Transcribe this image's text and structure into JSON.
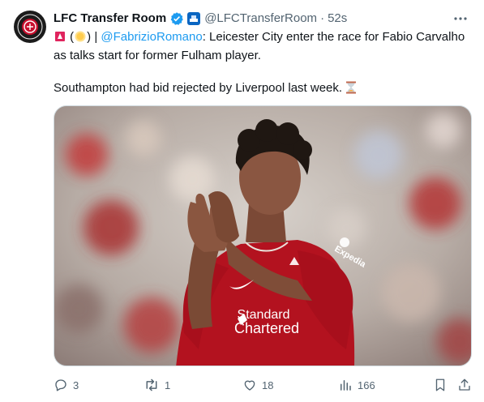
{
  "author": {
    "name": "LFC Transfer Room",
    "handle": "@LFCTransferRoom",
    "separator": "·",
    "time": "52s"
  },
  "tweet": {
    "line1_prefix": " (",
    "line1_mid": ") | ",
    "mention": "@FabrizioRomano",
    "line1_rest": ": Leicester City enter the race for Fabio Carvalho as talks start for former Fulham player.",
    "line2": "Southampton had bid rejected by Liverpool last week."
  },
  "media": {
    "shirt_sponsor_line1": "Standard",
    "shirt_sponsor_line2": "Chartered",
    "sleeve_sponsor": "Expedia"
  },
  "actions": {
    "replies": "3",
    "reposts": "1",
    "likes": "18",
    "views": "166"
  },
  "icons": {
    "verified": "verified-badge-icon",
    "affiliate": "affiliate-badge-icon",
    "more": "more-options-icon",
    "reply": "reply-icon",
    "repost": "repost-icon",
    "like": "heart-icon",
    "views": "views-icon",
    "bookmark": "bookmark-icon",
    "share": "share-icon"
  },
  "colors": {
    "link": "#1d9bf0",
    "verified": "#1d9bf0",
    "muted": "#536471",
    "shirt": "#b3121f"
  }
}
